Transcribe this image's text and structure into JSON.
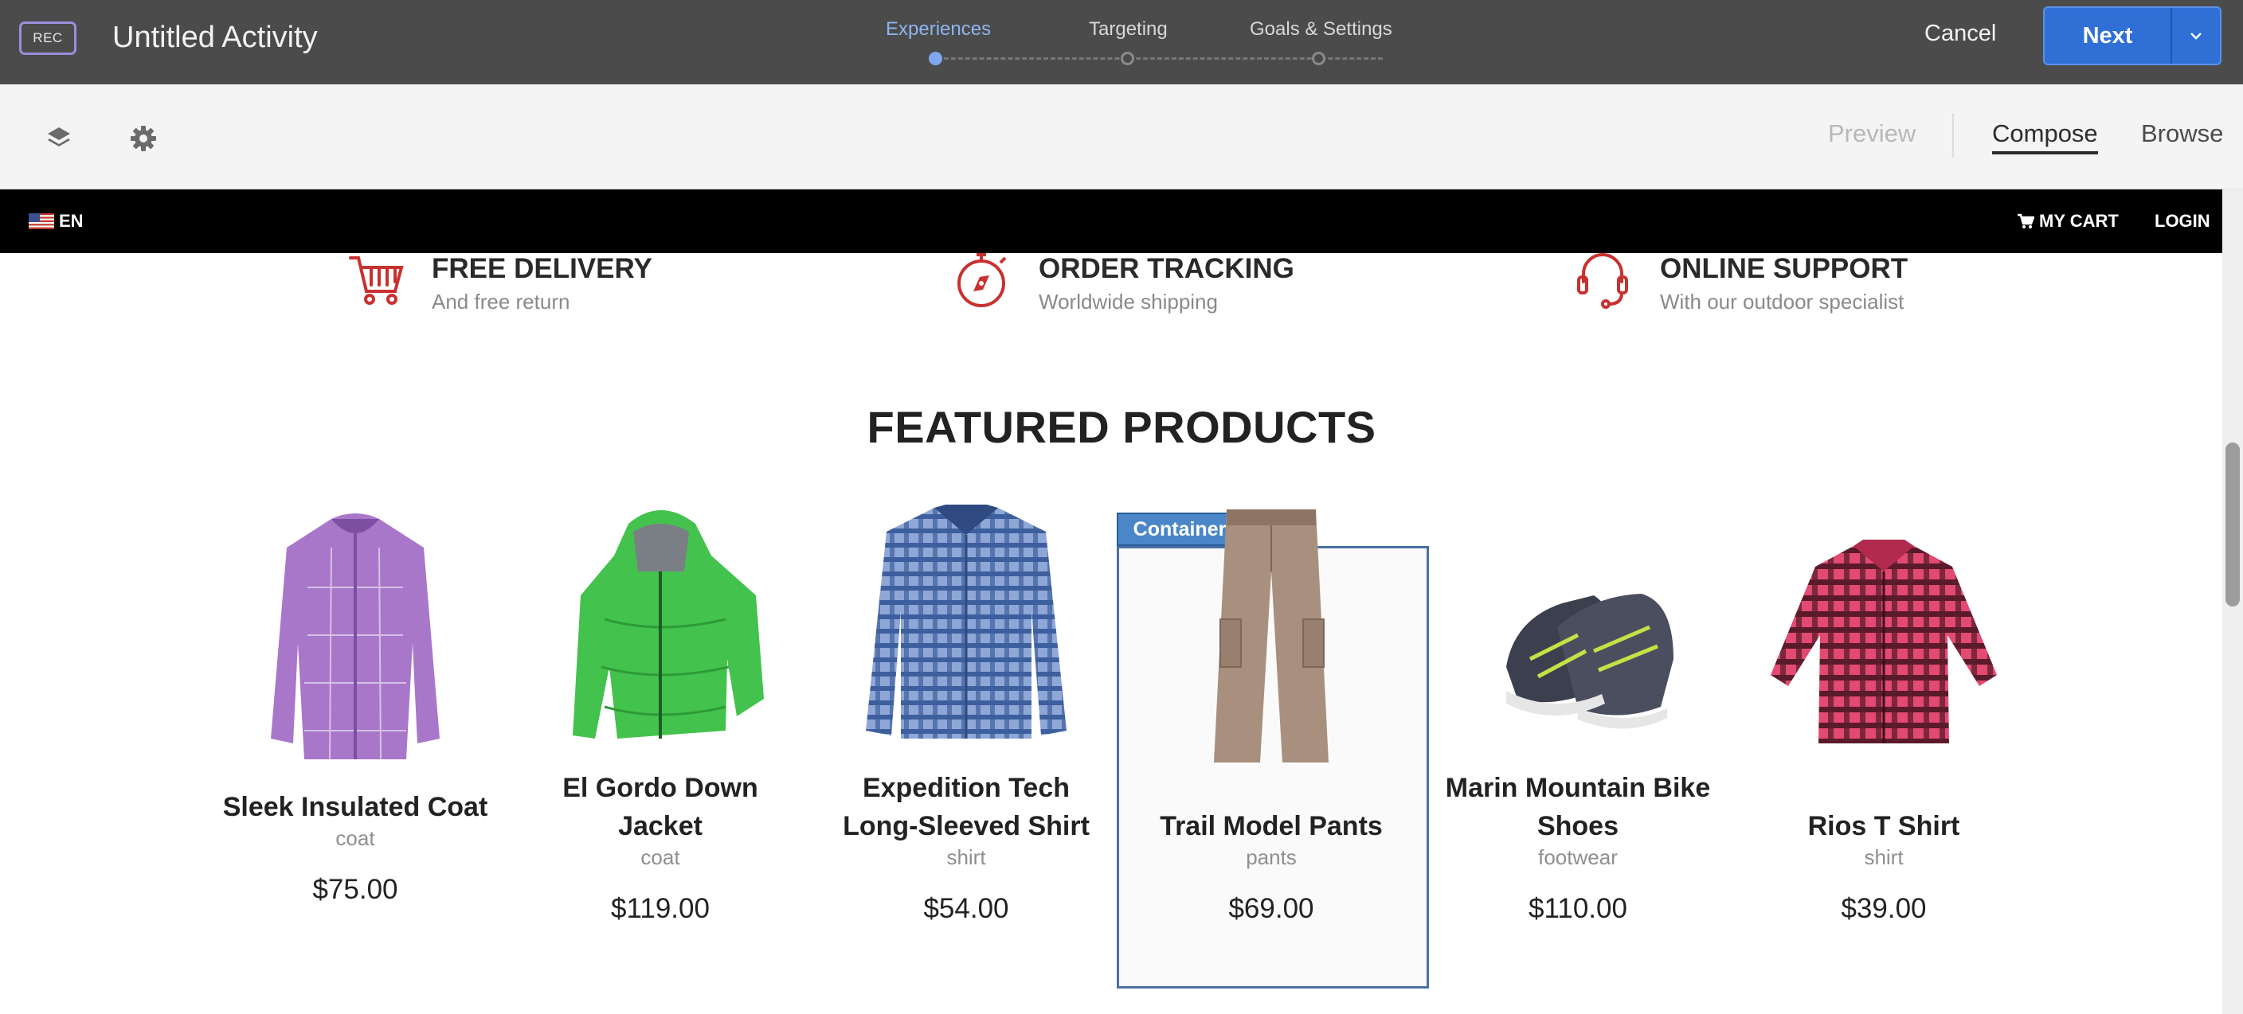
{
  "topbar": {
    "rec_label": "REC",
    "activity_title": "Untitled Activity",
    "steps": [
      "Experiences",
      "Targeting",
      "Goals & Settings"
    ],
    "active_step": "Experiences",
    "cancel_label": "Cancel",
    "next_label": "Next"
  },
  "toolbar": {
    "modes": [
      "Preview",
      "Compose",
      "Browse"
    ],
    "active_mode": "Compose"
  },
  "site_nav": {
    "language": "EN",
    "cart_label": "MY CART",
    "login_label": "LOGIN"
  },
  "features": [
    {
      "title": "FREE DELIVERY",
      "subtitle": "And free return",
      "icon": "cart-icon"
    },
    {
      "title": "ORDER TRACKING",
      "subtitle": "Worldwide shipping",
      "icon": "compass-icon"
    },
    {
      "title": "ONLINE SUPPORT",
      "subtitle": "With our outdoor specialist",
      "icon": "headset-icon"
    }
  ],
  "section_title": "FEATURED PRODUCTS",
  "selection_label": "Container",
  "products": [
    {
      "name_line1": "Sleek Insulated Coat",
      "name_line2": "",
      "category": "coat",
      "price": "$75.00",
      "color": "#a877c9"
    },
    {
      "name_line1": "El Gordo Down",
      "name_line2": "Jacket",
      "category": "coat",
      "price": "$119.00",
      "color": "#43c24d"
    },
    {
      "name_line1": "Expedition Tech",
      "name_line2": "Long-Sleeved Shirt",
      "category": "shirt",
      "price": "$54.00",
      "color": "#5f7fbf"
    },
    {
      "name_line1": "Trail Model Pants",
      "name_line2": "",
      "category": "pants",
      "price": "$69.00",
      "color": "#a88f7e"
    },
    {
      "name_line1": "Marin Mountain Bike",
      "name_line2": "Shoes",
      "category": "footwear",
      "price": "$110.00",
      "color": "#3c3f4d"
    },
    {
      "name_line1": "Rios T Shirt",
      "name_line2": "",
      "category": "shirt",
      "price": "$39.00",
      "color": "#e24a72"
    }
  ]
}
